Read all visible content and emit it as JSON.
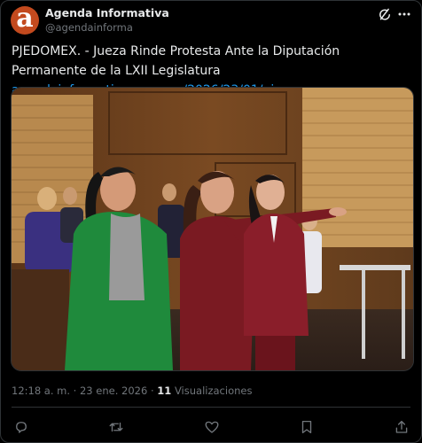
{
  "account": {
    "avatar_letter": "a",
    "name": "Agenda Informativa",
    "handle": "@agendainforma"
  },
  "tweet": {
    "text": "PJEDOMEX. - Jueza Rinde Protesta Ante la Diputación Permanente de la LXII Legislatura ",
    "link": "agendainformativa.com.mx/2026/23/01/pje…",
    "time": "12:18 a. m.",
    "separator": "·",
    "date": "23 ene. 2026",
    "views_count": "11",
    "views_label": "Visualizaciones"
  },
  "icons": {
    "grok": "grok-icon",
    "more": "more-icon",
    "reply": "reply-icon",
    "retweet": "retweet-icon",
    "like": "heart-icon",
    "bookmark": "bookmark-icon",
    "share": "share-icon"
  },
  "colors": {
    "background": "#000000",
    "text": "#e7e9ea",
    "secondary": "#71767b",
    "link": "#1d9bf0",
    "avatar": "#c34a1e",
    "border": "#2f3336"
  }
}
